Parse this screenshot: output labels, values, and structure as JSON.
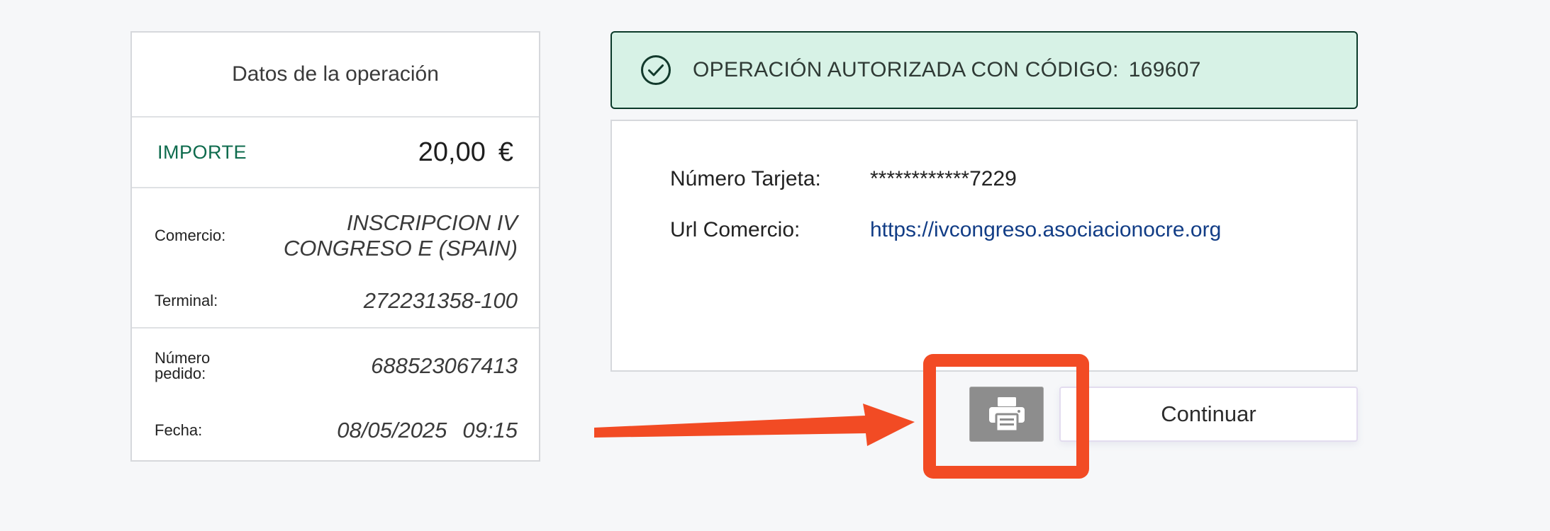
{
  "summary": {
    "title": "Datos de la operación",
    "amount_label": "IMPORTE",
    "amount": "20,00",
    "currency": "€",
    "comercio_label": "Comercio:",
    "comercio_line1": "INSCRIPCION IV",
    "comercio_line2": "CONGRESO E (SPAIN)",
    "terminal_label": "Terminal:",
    "terminal": "272231358-100",
    "pedido_label_line1": "Número",
    "pedido_label_line2": "pedido:",
    "pedido": "688523067413",
    "fecha_label": "Fecha:",
    "fecha_date": "08/05/2025",
    "fecha_time": "09:15"
  },
  "banner": {
    "text": "OPERACIÓN AUTORIZADA CON CÓDIGO:",
    "code": "169607",
    "icon": "check-circle-icon"
  },
  "details": {
    "card_label": "Número Tarjeta:",
    "card_value": "************7229",
    "url_label": "Url Comercio:",
    "url_value": "https://ivcongreso.asociacionocre.org"
  },
  "buttons": {
    "print_icon": "printer-icon",
    "continue_label": "Continuar"
  },
  "annotation": {
    "highlight_color": "#f24b24",
    "arrow_color": "#f24b24"
  },
  "colors": {
    "accent_green": "#0e6b4d",
    "banner_bg": "#d7f2e6",
    "link": "#123d86"
  }
}
